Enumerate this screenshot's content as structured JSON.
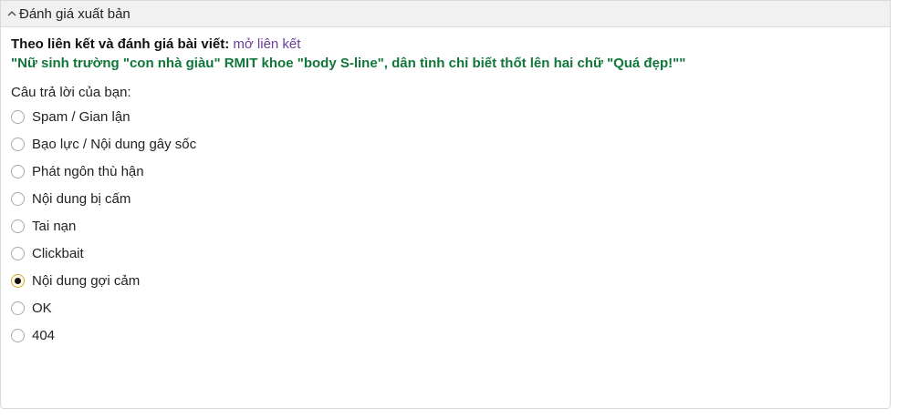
{
  "panel": {
    "title": "Đánh giá xuất bản"
  },
  "content": {
    "intro_label": "Theo liên kết và đánh giá bài viết:",
    "open_link": "mở liên kết",
    "article_title": "\"Nữ sinh trường \"con nhà giàu\" RMIT khoe \"body S-line\", dân tình chỉ biết thốt lên hai chữ \"Quá đẹp!\"\"",
    "question": "Câu trả lời của bạn:"
  },
  "options": [
    {
      "label": "Spam / Gian lận",
      "selected": false
    },
    {
      "label": "Bạo lực / Nội dung gây sốc",
      "selected": false
    },
    {
      "label": "Phát ngôn thù hận",
      "selected": false
    },
    {
      "label": "Nội dung bị cấm",
      "selected": false
    },
    {
      "label": "Tai nạn",
      "selected": false
    },
    {
      "label": "Clickbait",
      "selected": false
    },
    {
      "label": "Nội dung gợi cảm",
      "selected": true
    },
    {
      "label": "OK",
      "selected": false
    },
    {
      "label": "404",
      "selected": false
    }
  ],
  "colors": {
    "article_title": "#11763a",
    "link": "#6a3d9a",
    "header_bg": "#f1f1f1"
  },
  "icons": {
    "collapse": "chevron-up-icon"
  }
}
